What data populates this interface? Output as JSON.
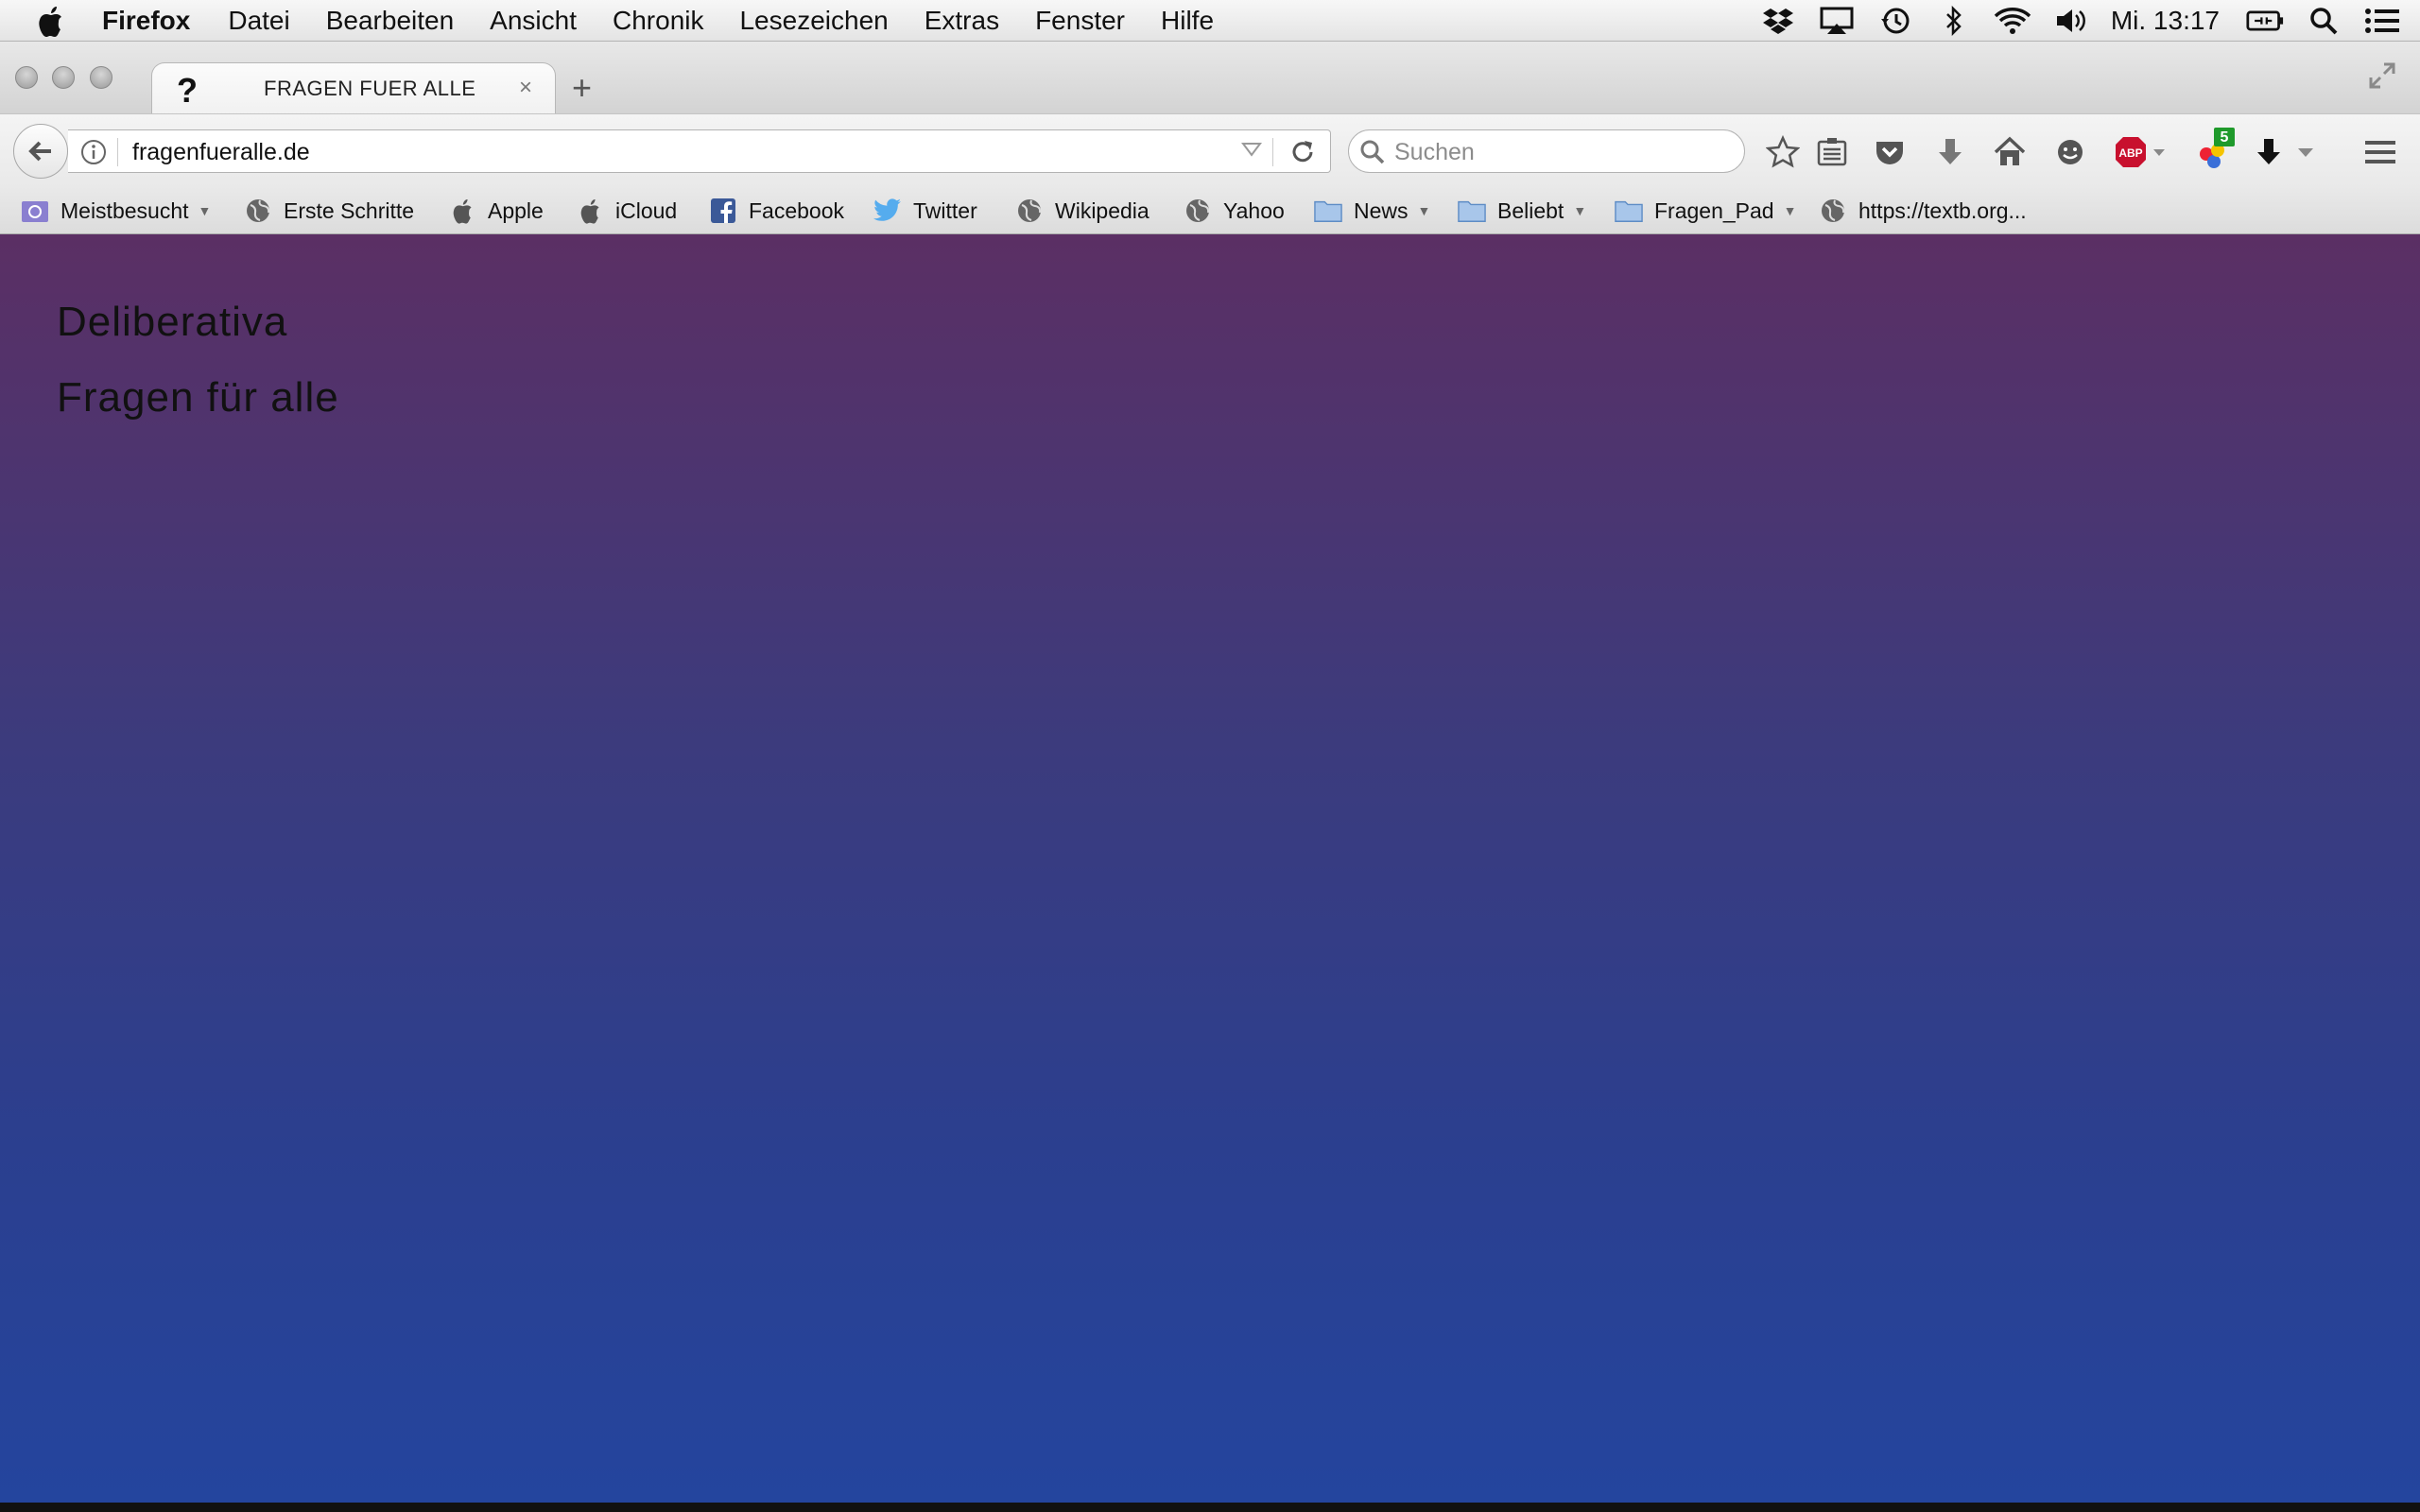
{
  "menubar": {
    "app_name": "Firefox",
    "items": [
      "Datei",
      "Bearbeiten",
      "Ansicht",
      "Chronik",
      "Lesezeichen",
      "Extras",
      "Fenster",
      "Hilfe"
    ],
    "clock": "Mi. 13:17",
    "status_icons": [
      "dropbox-icon",
      "airplay-icon",
      "time-machine-icon",
      "bluetooth-icon",
      "wifi-icon",
      "volume-icon",
      "battery-icon",
      "spotlight-icon",
      "notification-center-icon"
    ]
  },
  "tab": {
    "favicon": "?",
    "title": "FRAGEN FUER ALLE",
    "close": "×"
  },
  "new_tab": "+",
  "navbar": {
    "url": "fragenfueralle.de",
    "search_placeholder": "Suchen",
    "addon_badge": "5",
    "abp_label": "ABP"
  },
  "bookmarks": [
    {
      "label": "Meistbesucht",
      "icon": "smart-folder-icon",
      "dropdown": true
    },
    {
      "label": "Erste Schritte",
      "icon": "globe-icon",
      "dropdown": false
    },
    {
      "label": "Apple",
      "icon": "apple-icon",
      "dropdown": false
    },
    {
      "label": "iCloud",
      "icon": "apple-icon",
      "dropdown": false
    },
    {
      "label": "Facebook",
      "icon": "facebook-icon",
      "dropdown": false
    },
    {
      "label": "Twitter",
      "icon": "twitter-icon",
      "dropdown": false
    },
    {
      "label": "Wikipedia",
      "icon": "globe-icon",
      "dropdown": false
    },
    {
      "label": "Yahoo",
      "icon": "globe-icon",
      "dropdown": false
    },
    {
      "label": "News",
      "icon": "folder-icon",
      "dropdown": true
    },
    {
      "label": "Beliebt",
      "icon": "folder-icon",
      "dropdown": true
    },
    {
      "label": "Fragen_Pad",
      "icon": "folder-icon",
      "dropdown": true
    },
    {
      "label": "https://textb.org...",
      "icon": "globe-icon",
      "dropdown": false
    }
  ],
  "page": {
    "site_name": "Deliberativa",
    "tagline": "Fragen für alle"
  },
  "colors": {
    "page_gradient_top": "#5b2f64",
    "page_gradient_bottom": "#24459e",
    "abp_red": "#c8102e",
    "badge_green": "#1f9a2b",
    "facebook_blue": "#3b5998",
    "twitter_blue": "#55acee",
    "folder_blue": "#7aa7d8"
  }
}
